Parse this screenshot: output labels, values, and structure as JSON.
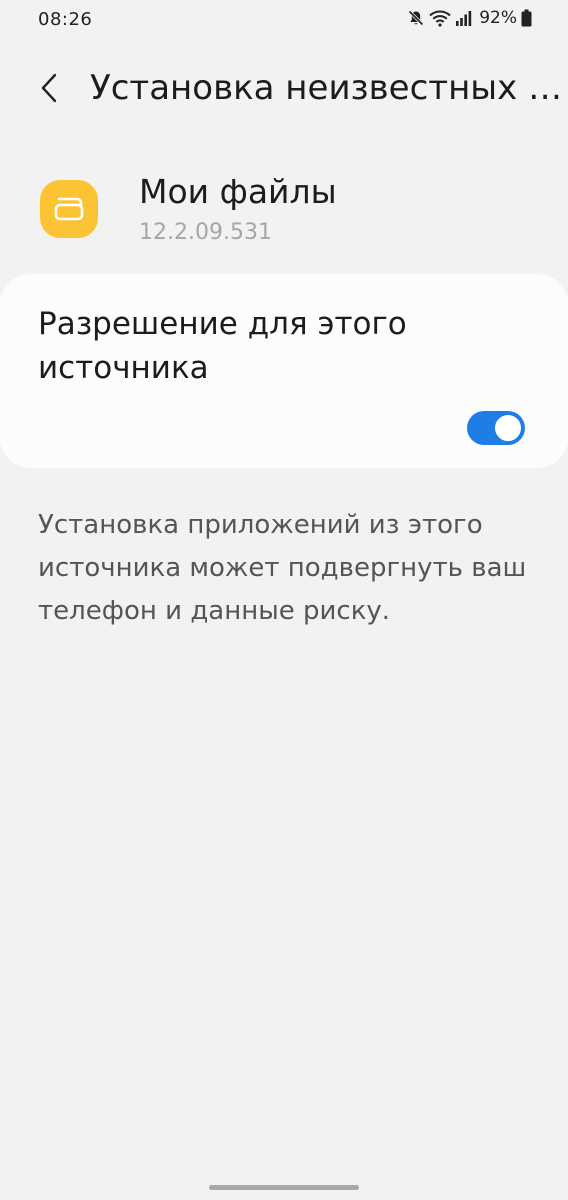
{
  "status_bar": {
    "time": "08:26",
    "battery": "92%",
    "icons": [
      "mute-icon",
      "wifi-icon",
      "signal-icon",
      "battery-icon"
    ]
  },
  "app_bar": {
    "title": "Установка неизвестных приложений"
  },
  "app_info": {
    "name": "Мои файлы",
    "version": "12.2.09.531",
    "icon": "my-files-folder-icon",
    "icon_color": "#fcc434"
  },
  "permission": {
    "label": "Разрешение для этого источника",
    "enabled": true,
    "accent_color": "#1f7de6"
  },
  "warning": {
    "text": "Установка приложений из этого источника может подвергнуть ваш телефон и данные риску."
  }
}
